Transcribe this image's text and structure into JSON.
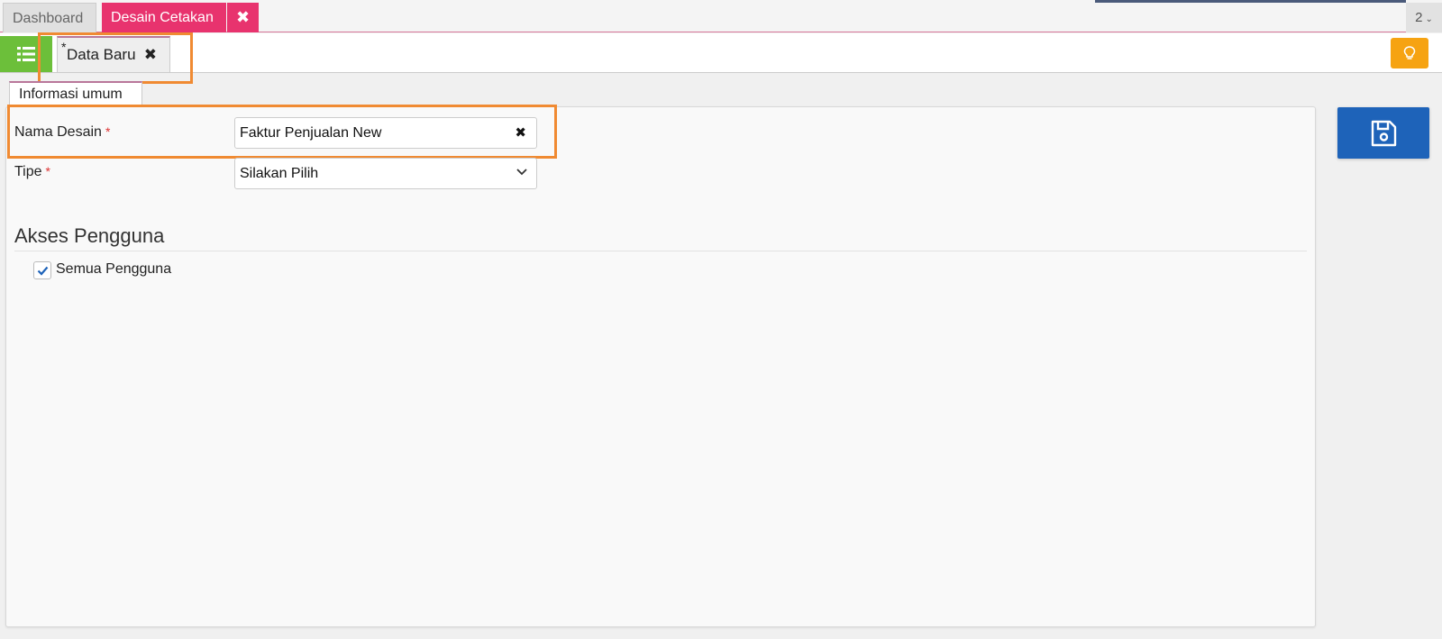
{
  "top_tabs": [
    {
      "label": "Dashboard",
      "active": false
    },
    {
      "label": "Desain Cetakan",
      "active": true
    }
  ],
  "tab_close_glyph": "✖",
  "tab_counter": {
    "value": "2",
    "icon": "chevron-down-icon"
  },
  "subbar": {
    "list_button_icon": "list-icon",
    "document_tab": {
      "modified_marker": "*",
      "label": "Data Baru",
      "close_glyph": "✖"
    },
    "hint_button_icon": "lightbulb-icon"
  },
  "section_tab": "Informasi umum",
  "form": {
    "nama_desain": {
      "label": "Nama Desain",
      "required_mark": "*",
      "value": "Faktur Penjualan New",
      "clear_glyph": "✖"
    },
    "tipe": {
      "label": "Tipe",
      "required_mark": "*",
      "value": "Silakan Pilih"
    }
  },
  "akses": {
    "title": "Akses Pengguna",
    "semua_pengguna": {
      "label": "Semua Pengguna",
      "checked": true
    }
  },
  "save_button_icon": "floppy-disk-icon",
  "colors": {
    "active_tab": "#e8336e",
    "list_button": "#6cbf3a",
    "hint_button": "#f6a312",
    "save_button": "#1e63b9",
    "highlight": "#f08a32",
    "required": "#dd3333"
  }
}
